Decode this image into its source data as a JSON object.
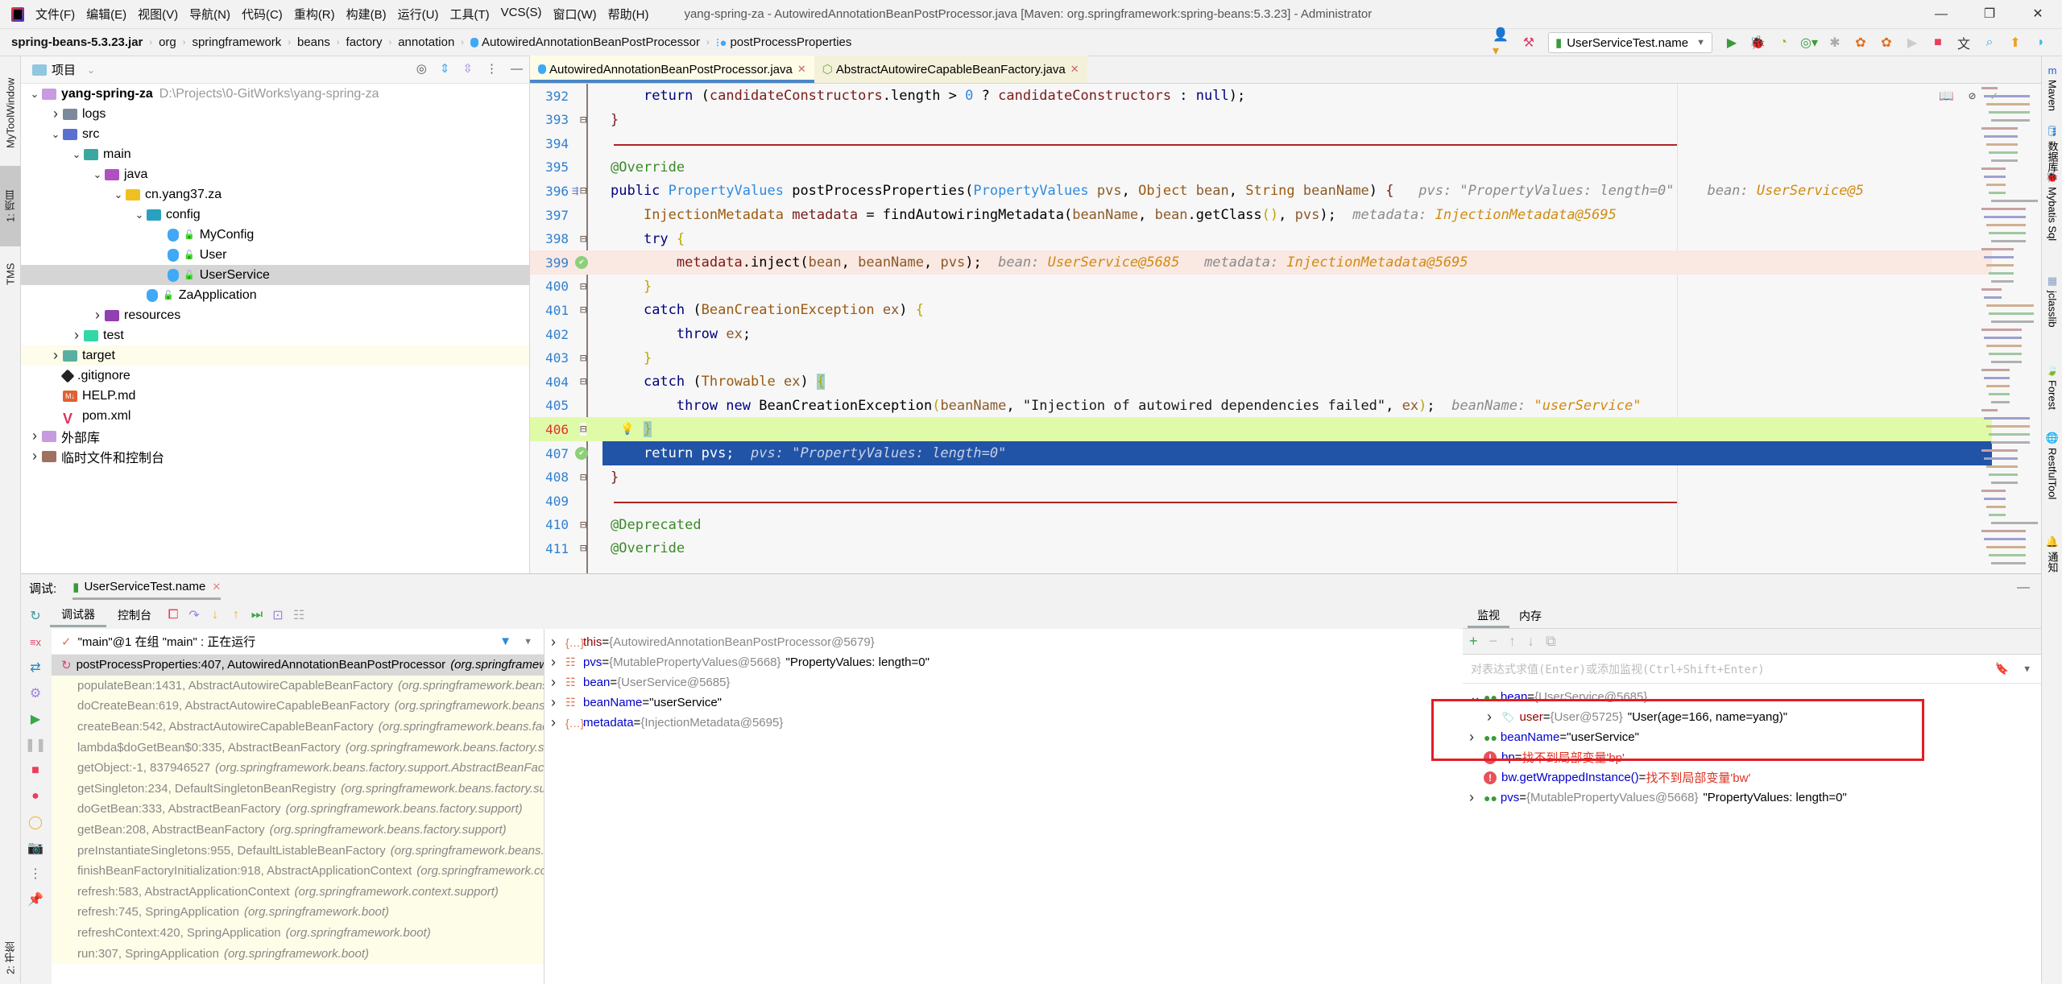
{
  "menu": [
    "文件(F)",
    "编辑(E)",
    "视图(V)",
    "导航(N)",
    "代码(C)",
    "重构(R)",
    "构建(B)",
    "运行(U)",
    "工具(T)",
    "VCS(S)",
    "窗口(W)",
    "帮助(H)"
  ],
  "window_title": "yang-spring-za - AutowiredAnnotationBeanPostProcessor.java [Maven: org.springframework:spring-beans:5.3.23] - Administrator",
  "breadcrumbs": [
    "spring-beans-5.3.23.jar",
    "org",
    "springframework",
    "beans",
    "factory",
    "annotation",
    "AutowiredAnnotationBeanPostProcessor",
    "postProcessProperties"
  ],
  "run_config": "UserServiceTest.name",
  "left_strip": {
    "tool1": "MyToolWindow",
    "tool2": "1: 项目",
    "tool3": "TMS",
    "tool4": "2: 书签"
  },
  "right_strip": [
    "Maven",
    "数据库",
    "Mybatis Sql",
    "jclasslib",
    "Forest",
    "RestfulTool",
    "通知"
  ],
  "project": {
    "title": "项目",
    "tree": [
      {
        "label": "yang-spring-za",
        "extra": "D:\\Projects\\0-GitWorks\\yang-spring-za",
        "depth": 0,
        "arrow": "open",
        "icon": "module"
      },
      {
        "label": "logs",
        "depth": 1,
        "arrow": "closed",
        "icon": "folder"
      },
      {
        "label": "src",
        "depth": 1,
        "arrow": "open",
        "icon": "src-folder"
      },
      {
        "label": "main",
        "depth": 2,
        "arrow": "open",
        "icon": "folder-teal"
      },
      {
        "label": "java",
        "depth": 3,
        "arrow": "open",
        "icon": "java-folder"
      },
      {
        "label": "cn.yang37.za",
        "depth": 4,
        "arrow": "open",
        "icon": "package"
      },
      {
        "label": "config",
        "depth": 5,
        "arrow": "open",
        "icon": "config-folder"
      },
      {
        "label": "MyConfig",
        "depth": 6,
        "arrow": "none",
        "icon": "class"
      },
      {
        "label": "User",
        "depth": 6,
        "arrow": "none",
        "icon": "class"
      },
      {
        "label": "UserService",
        "depth": 6,
        "arrow": "none",
        "icon": "class",
        "selected": true
      },
      {
        "label": "ZaApplication",
        "depth": 5,
        "arrow": "none",
        "icon": "spring-class"
      },
      {
        "label": "resources",
        "depth": 3,
        "arrow": "closed",
        "icon": "resources-folder"
      },
      {
        "label": "test",
        "depth": 2,
        "arrow": "closed",
        "icon": "test-folder"
      },
      {
        "label": "target",
        "depth": 1,
        "arrow": "closed",
        "icon": "target-folder",
        "highlight": true
      },
      {
        "label": ".gitignore",
        "depth": 1,
        "arrow": "none",
        "icon": "git"
      },
      {
        "label": "HELP.md",
        "depth": 1,
        "arrow": "none",
        "icon": "markdown"
      },
      {
        "label": "pom.xml",
        "depth": 1,
        "arrow": "none",
        "icon": "maven"
      },
      {
        "label": "外部库",
        "depth": 0,
        "arrow": "closed",
        "icon": "library"
      },
      {
        "label": "临时文件和控制台",
        "depth": 0,
        "arrow": "closed",
        "icon": "scratch"
      }
    ]
  },
  "editor": {
    "tabs": [
      {
        "label": "AutowiredAnnotationBeanPostProcessor.java",
        "active": true
      },
      {
        "label": "AbstractAutowireCapableBeanFactory.java",
        "active": false
      }
    ],
    "lines": [
      {
        "n": "392",
        "html": "    <span class='kw'>return</span> (<span class='va'>candidateConstructors</span>.length &gt; <span class='ty'>0</span> ? <span class='va'>candidateConstructors</span> : <span class='kw'>null</span>);"
      },
      {
        "n": "393",
        "html": "<span class='va'>}</span>"
      },
      {
        "n": "394",
        "html": ""
      },
      {
        "n": "395",
        "html": "<span class='an'>@Override</span>"
      },
      {
        "n": "396",
        "html": "<span class='kw'>public</span> <span class='ty'>PropertyValues</span> postProcessProperties(<span class='ty'>PropertyValues</span> <span class='pa'>pvs</span>, <span class='tyb'>Object</span> <span class='pa'>bean</span>, <span class='tyb'>String</span> <span class='pa'>beanName</span>) <span class='va'>{</span>   <span class='hint'>pvs: \"PropertyValues: length=0\"    bean: </span><span class='hval'>UserService@5</span>"
      },
      {
        "n": "397",
        "html": "    <span class='tyb'>InjectionMetadata</span> <span class='va'>metadata</span> = findAutowiringMetadata(<span class='pa'>beanName</span>, <span class='pa'>bean</span>.getClass<span class='br'>()</span>, <span class='pa'>pvs</span>);  <span class='hint'>metadata: </span><span class='hval'>InjectionMetadata@5695</span>"
      },
      {
        "n": "398",
        "html": "    <span class='kw'>try</span> <span class='br'>{</span>"
      },
      {
        "n": "399",
        "html": "        <span class='va'>metadata</span>.inject(<span class='pa'>bean</span>, <span class='pa'>beanName</span>, <span class='pa'>pvs</span>);  <span class='hint'>bean: </span><span class='hval'>UserService@5685</span>   <span class='hint'>metadata: </span><span class='hval'>InjectionMetadata@5695</span>"
      },
      {
        "n": "400",
        "html": "    <span class='br'>}</span>"
      },
      {
        "n": "401",
        "html": "    <span class='kw'>catch</span> (<span class='tyb'>BeanCreationException</span> <span class='pa'>ex</span>) <span class='br'>{</span>"
      },
      {
        "n": "402",
        "html": "        <span class='kw'>throw</span> <span class='pa'>ex</span>;"
      },
      {
        "n": "403",
        "html": "    <span class='br'>}</span>"
      },
      {
        "n": "404",
        "html": "    <span class='kw'>catch</span> (<span class='tyb'>Throwable</span> <span class='pa'>ex</span>) <span class='br' style='background:#9fd0c0'>{</span>"
      },
      {
        "n": "405",
        "html": "        <span class='kw'>throw new</span> BeanCreationException<span class='br'>(</span><span class='pa'>beanName</span>, <span class='st'>\"Injection of autowired dependencies failed\"</span>, <span class='pa'>ex</span><span class='br'>)</span>;  <span class='hint'>beanName: </span><span class='hval'>\"userService\"</span>"
      },
      {
        "n": "406",
        "html": "    <span class='br' style='background:#9fd0c0'>}</span>"
      },
      {
        "n": "407",
        "html": "    <span style='color:#fff'>return pvs;</span>  <span class='hint' style='color:#c8d0e8'>pvs: \"PropertyValues: length=0\"</span>"
      },
      {
        "n": "408",
        "html": "<span class='va'>}</span>"
      },
      {
        "n": "409",
        "html": ""
      },
      {
        "n": "410",
        "html": "<span class='an'>@Deprecated</span>"
      },
      {
        "n": "411",
        "html": "<span class='an'>@Override</span>"
      }
    ]
  },
  "debug": {
    "label": "调试:",
    "session": "UserServiceTest.name",
    "tabs": [
      "调试器",
      "控制台"
    ],
    "thread": "\"main\"@1 在组 \"main\" : 正在运行",
    "frames": [
      {
        "m": "postProcessProperties:407, AutowiredAnnotationBeanPostProcessor",
        "p": "(org.springframework.beans.factory.annotation)"
      },
      {
        "m": "populateBean:1431, AbstractAutowireCapableBeanFactory",
        "p": "(org.springframework.beans.factory.support)"
      },
      {
        "m": "doCreateBean:619, AbstractAutowireCapableBeanFactory",
        "p": "(org.springframework.beans.factory.support)"
      },
      {
        "m": "createBean:542, AbstractAutowireCapableBeanFactory",
        "p": "(org.springframework.beans.factory.support)"
      },
      {
        "m": "lambda$doGetBean$0:335, AbstractBeanFactory",
        "p": "(org.springframework.beans.factory.support)"
      },
      {
        "m": "getObject:-1, 837946527",
        "p": "(org.springframework.beans.factory.support.AbstractBeanFactory)"
      },
      {
        "m": "getSingleton:234, DefaultSingletonBeanRegistry",
        "p": "(org.springframework.beans.factory.support)"
      },
      {
        "m": "doGetBean:333, AbstractBeanFactory",
        "p": "(org.springframework.beans.factory.support)"
      },
      {
        "m": "getBean:208, AbstractBeanFactory",
        "p": "(org.springframework.beans.factory.support)"
      },
      {
        "m": "preInstantiateSingletons:955, DefaultListableBeanFactory",
        "p": "(org.springframework.beans.factory.support)"
      },
      {
        "m": "finishBeanFactoryInitialization:918, AbstractApplicationContext",
        "p": "(org.springframework.context.support)"
      },
      {
        "m": "refresh:583, AbstractApplicationContext",
        "p": "(org.springframework.context.support)"
      },
      {
        "m": "refresh:745, SpringApplication",
        "p": "(org.springframework.boot)"
      },
      {
        "m": "refreshContext:420, SpringApplication",
        "p": "(org.springframework.boot)"
      },
      {
        "m": "run:307, SpringApplication",
        "p": "(org.springframework.boot)"
      }
    ],
    "variables": [
      {
        "name": "this",
        "type": "{AutowiredAnnotationBeanPostProcessor@5679}",
        "value": "",
        "icon": "object"
      },
      {
        "name": "pvs",
        "type": "{MutablePropertyValues@5668}",
        "value": "\"PropertyValues: length=0\"",
        "icon": "param"
      },
      {
        "name": "bean",
        "type": "{UserService@5685}",
        "value": "",
        "icon": "param"
      },
      {
        "name": "beanName",
        "type": "",
        "value": "\"userService\"",
        "icon": "param"
      },
      {
        "name": "metadata",
        "type": "{InjectionMetadata@5695}",
        "value": "",
        "icon": "object"
      }
    ],
    "watch_tabs": [
      "监视",
      "内存"
    ],
    "watch_placeholder": "对表达式求值(Enter)或添加监视(Ctrl+Shift+Enter)",
    "watches": [
      {
        "name": "bean",
        "type": "{UserService@5685}",
        "value": "",
        "arrow": "open",
        "kind": "watch",
        "indent": 0
      },
      {
        "name": "user",
        "type": "{User@5725}",
        "value": "\"User(age=166, name=yang)\"",
        "arrow": "closed",
        "kind": "field",
        "indent": 1
      },
      {
        "name": "beanName",
        "type": "",
        "value": "\"userService\"",
        "arrow": "closed",
        "kind": "watch",
        "indent": 0
      },
      {
        "name": "bp",
        "type": "",
        "value": "找不到局部变量'bp'",
        "arrow": "none",
        "kind": "error",
        "indent": 0
      },
      {
        "name": "bw.getWrappedInstance()",
        "type": "",
        "value": "找不到局部变量'bw'",
        "arrow": "none",
        "kind": "error",
        "indent": 0
      },
      {
        "name": "pvs",
        "type": "{MutablePropertyValues@5668}",
        "value": "\"PropertyValues: length=0\"",
        "arrow": "closed",
        "kind": "watch",
        "indent": 0
      }
    ]
  }
}
